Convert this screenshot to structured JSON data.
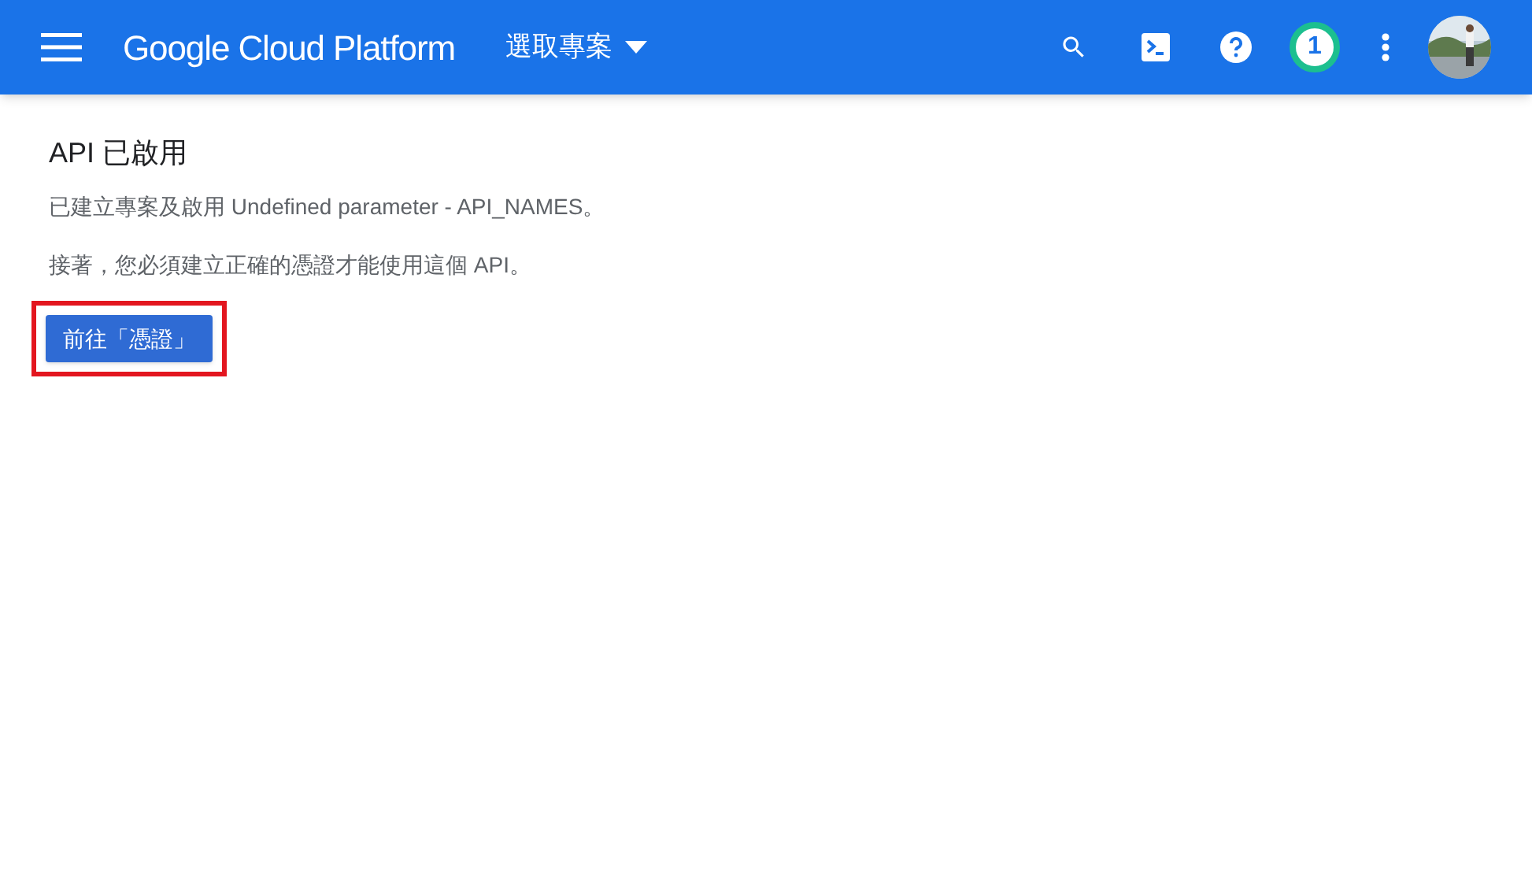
{
  "header": {
    "brand": "Google Cloud Platform",
    "project_picker": "選取專案",
    "notification_count": "1"
  },
  "content": {
    "title": "API 已啟用",
    "paragraphs": [
      "已建立專案及啟用 Undefined parameter - API_NAMES。",
      "接著，您必須建立正確的憑證才能使用這個 API。"
    ],
    "button": {
      "label": "前往「憑證」",
      "highlighted": true
    }
  }
}
